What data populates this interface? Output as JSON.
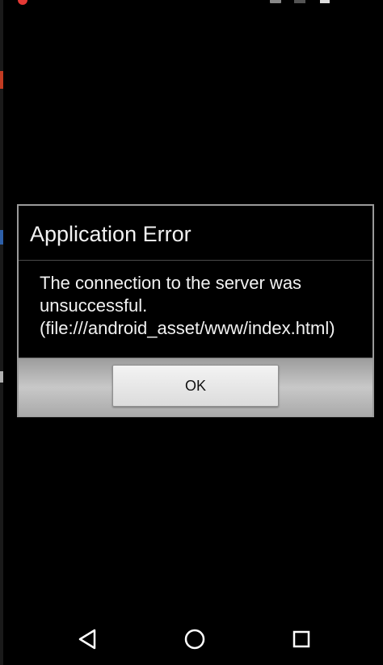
{
  "dialog": {
    "title": "Application Error",
    "message": "The connection to the server was unsuccessful. (file:///android_asset/www/index.html)",
    "ok_label": "OK"
  },
  "navigation": {
    "back_icon": "back-triangle-icon",
    "home_icon": "home-circle-icon",
    "recents_icon": "recents-square-icon"
  },
  "colors": {
    "background": "#000000",
    "dialog_border": "#9a9a9a",
    "text": "#f2f2f2",
    "status_dot": "#e53935"
  }
}
